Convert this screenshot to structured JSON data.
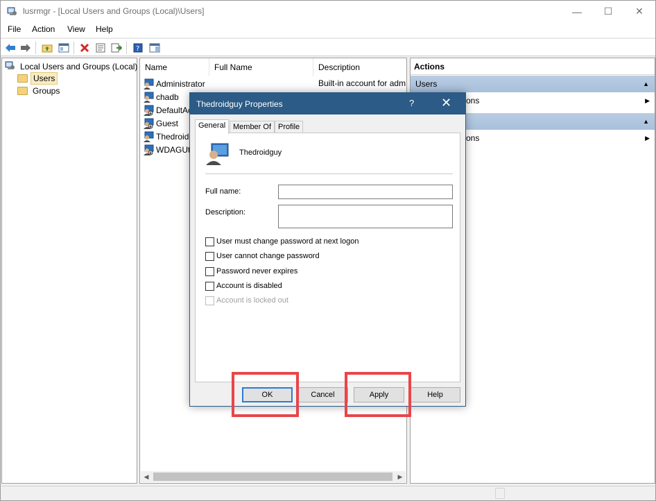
{
  "window": {
    "title": "lusrmgr - [Local Users and Groups (Local)\\Users]",
    "controls": {
      "minimize": "—",
      "maximize": "☐",
      "close": "✕"
    }
  },
  "menu": [
    "File",
    "Action",
    "View",
    "Help"
  ],
  "toolbar": {
    "icons": [
      "back-icon",
      "forward-icon",
      "up-folder-icon",
      "show-hide-tree-icon",
      "delete-icon",
      "properties-icon",
      "export-list-icon",
      "help-icon",
      "show-hide-action-pane-icon"
    ]
  },
  "tree": {
    "root": "Local Users and Groups (Local)",
    "children": [
      "Users",
      "Groups"
    ],
    "selected": "Users"
  },
  "list": {
    "columns": [
      "Name",
      "Full Name",
      "Description"
    ],
    "rows": [
      {
        "name": "Administrator",
        "full_name": "",
        "description": "Built-in account for adm"
      },
      {
        "name": "chadb",
        "full_name": "",
        "description": ""
      },
      {
        "name": "DefaultAc",
        "full_name": "",
        "description": ""
      },
      {
        "name": "Guest",
        "full_name": "",
        "description": ""
      },
      {
        "name": "Thedroidg",
        "full_name": "",
        "description": ""
      },
      {
        "name": "WDAGUti",
        "full_name": "",
        "description": ""
      }
    ]
  },
  "actions": {
    "title": "Actions",
    "sections": [
      {
        "header": "Users",
        "item": "ons"
      },
      {
        "header": "",
        "item": "ons"
      }
    ]
  },
  "dialog": {
    "title": "Thedroidguy Properties",
    "help": "?",
    "close": "✕",
    "tabs": [
      "General",
      "Member Of",
      "Profile"
    ],
    "active_tab": "General",
    "username": "Thedroidguy",
    "full_name_label": "Full name:",
    "full_name_value": "",
    "description_label": "Description:",
    "description_value": "",
    "checkboxes": [
      {
        "label": "User must change password at next logon",
        "checked": false,
        "enabled": true
      },
      {
        "label": "User cannot change password",
        "checked": false,
        "enabled": true
      },
      {
        "label": "Password never expires",
        "checked": false,
        "enabled": true
      },
      {
        "label": "Account is disabled",
        "checked": false,
        "enabled": true
      },
      {
        "label": "Account is locked out",
        "checked": false,
        "enabled": false
      }
    ],
    "buttons": {
      "ok": "OK",
      "cancel": "Cancel",
      "apply": "Apply",
      "help": "Help"
    },
    "highlight_color": "#e8454a",
    "accent_color": "#2b5b86"
  }
}
